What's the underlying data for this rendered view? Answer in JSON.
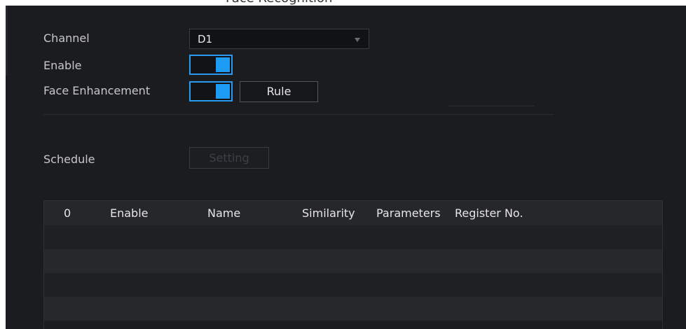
{
  "window": {
    "title": "Face Recognition"
  },
  "form": {
    "channel_label": "Channel",
    "channel_value": "D1",
    "enable_label": "Enable",
    "enable_on": true,
    "face_enhancement_label": "Face Enhancement",
    "face_enhancement_on": true,
    "rule_button": "Rule",
    "schedule_label": "Schedule",
    "setting_button": "Setting"
  },
  "table": {
    "columns": [
      "0",
      "Enable",
      "Name",
      "Similarity",
      "Parameters",
      "Register No."
    ],
    "rows": [
      [],
      [],
      [],
      []
    ]
  },
  "colors": {
    "panel_bg": "#1b1c20",
    "accent": "#1d9bf5",
    "header_bg": "#26272b"
  }
}
